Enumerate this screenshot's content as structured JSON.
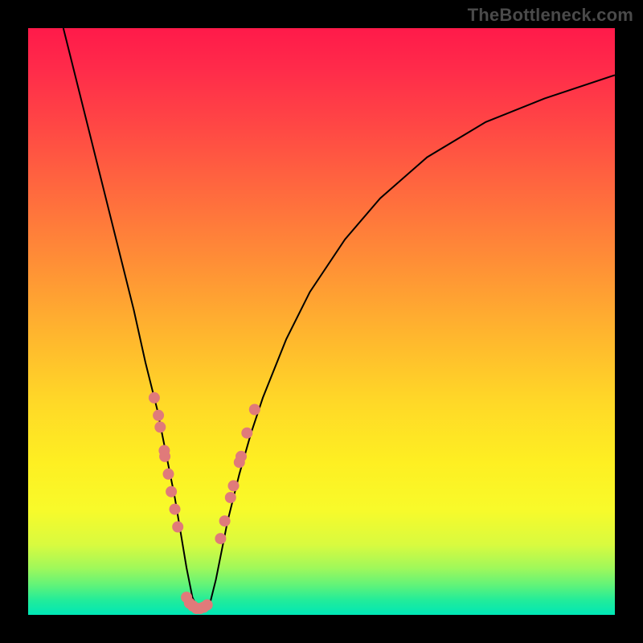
{
  "watermark": "TheBottleneck.com",
  "colors": {
    "frame": "#000000",
    "gradient_top": "#ff1a4a",
    "gradient_bottom": "#00e7b6",
    "curve": "#000000",
    "dots": "#e07a7a"
  },
  "chart_data": {
    "type": "line",
    "title": "",
    "xlabel": "",
    "ylabel": "",
    "xlim": [
      0,
      100
    ],
    "ylim": [
      0,
      100
    ],
    "grid": false,
    "note": "Axes are implicit (no tick labels shown). y=100 at top (red/high bottleneck), y=0 at bottom (green/no bottleneck). Curve dips to ~0 near x≈29 then rises.",
    "series": [
      {
        "name": "bottleneck-curve",
        "x": [
          6,
          8,
          10,
          12,
          14,
          16,
          18,
          20,
          22,
          23,
          24,
          25,
          26,
          27,
          28,
          29,
          30,
          31,
          32,
          33,
          34,
          36,
          38,
          40,
          44,
          48,
          54,
          60,
          68,
          78,
          88,
          100
        ],
        "y": [
          100,
          92,
          84,
          76,
          68,
          60,
          52,
          43,
          35,
          30,
          25,
          20,
          14,
          8,
          3,
          0.8,
          0.8,
          2,
          6,
          11,
          16,
          24,
          31,
          37,
          47,
          55,
          64,
          71,
          78,
          84,
          88,
          92
        ]
      }
    ],
    "markers": {
      "name": "highlight-dots",
      "note": "Salmon dots clustered along the valley of the curve where it nears the green band and at the trough.",
      "points": [
        {
          "x": 21.5,
          "y": 37
        },
        {
          "x": 22.2,
          "y": 34
        },
        {
          "x": 22.5,
          "y": 32
        },
        {
          "x": 23.2,
          "y": 28
        },
        {
          "x": 23.3,
          "y": 27
        },
        {
          "x": 23.9,
          "y": 24
        },
        {
          "x": 24.4,
          "y": 21
        },
        {
          "x": 25.0,
          "y": 18
        },
        {
          "x": 25.5,
          "y": 15
        },
        {
          "x": 27.0,
          "y": 3
        },
        {
          "x": 27.5,
          "y": 2
        },
        {
          "x": 28.1,
          "y": 1.5
        },
        {
          "x": 28.7,
          "y": 1.1
        },
        {
          "x": 29.3,
          "y": 1.1
        },
        {
          "x": 29.9,
          "y": 1.3
        },
        {
          "x": 30.5,
          "y": 1.7
        },
        {
          "x": 32.8,
          "y": 13
        },
        {
          "x": 33.5,
          "y": 16
        },
        {
          "x": 34.5,
          "y": 20
        },
        {
          "x": 35.0,
          "y": 22
        },
        {
          "x": 36.0,
          "y": 26
        },
        {
          "x": 36.3,
          "y": 27
        },
        {
          "x": 37.3,
          "y": 31
        },
        {
          "x": 38.6,
          "y": 35
        }
      ]
    }
  }
}
